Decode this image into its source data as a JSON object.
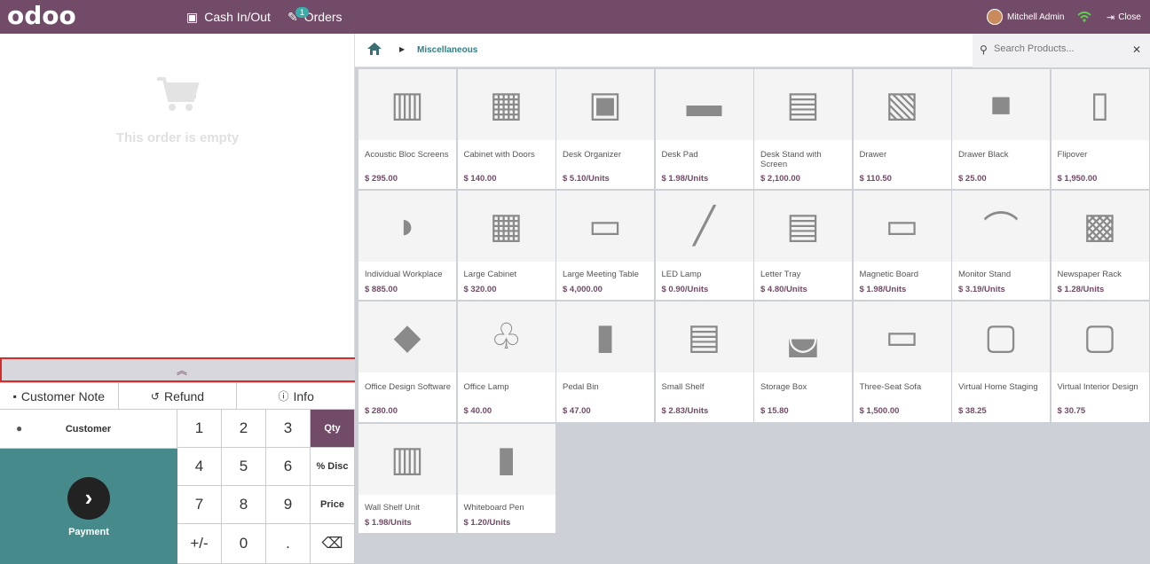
{
  "topbar": {
    "logo": "odoo",
    "cash_label": "Cash In/Out",
    "orders_label": "Orders",
    "orders_badge": "1",
    "user_name": "Mitchell Admin",
    "close_label": "Close",
    "bg_color": "#714b67"
  },
  "order": {
    "empty_text": "This order is empty"
  },
  "controls": {
    "customer_note": "Customer Note",
    "refund": "Refund",
    "info": "Info"
  },
  "numpad": {
    "customer": "Customer",
    "payment": "Payment",
    "keys": [
      "1",
      "2",
      "3",
      "4",
      "5",
      "6",
      "7",
      "8",
      "9",
      "+/-",
      "0",
      "."
    ],
    "qty": "Qty",
    "disc": "% Disc",
    "price": "Price"
  },
  "products_bar": {
    "category": "Miscellaneous",
    "search_placeholder": "Search Products..."
  },
  "products": [
    {
      "name": "Acoustic Bloc Screens",
      "price": "$ 295.00"
    },
    {
      "name": "Cabinet with Doors",
      "price": "$ 140.00"
    },
    {
      "name": "Desk Organizer",
      "price": "$ 5.10/Units"
    },
    {
      "name": "Desk Pad",
      "price": "$ 1.98/Units"
    },
    {
      "name": "Desk Stand with Screen",
      "price": "$ 2,100.00"
    },
    {
      "name": "Drawer",
      "price": "$ 110.50"
    },
    {
      "name": "Drawer Black",
      "price": "$ 25.00"
    },
    {
      "name": "Flipover",
      "price": "$ 1,950.00"
    },
    {
      "name": "Individual Workplace",
      "price": "$ 885.00"
    },
    {
      "name": "Large Cabinet",
      "price": "$ 320.00"
    },
    {
      "name": "Large Meeting Table",
      "price": "$ 4,000.00"
    },
    {
      "name": "LED Lamp",
      "price": "$ 0.90/Units"
    },
    {
      "name": "Letter Tray",
      "price": "$ 4.80/Units"
    },
    {
      "name": "Magnetic Board",
      "price": "$ 1.98/Units"
    },
    {
      "name": "Monitor Stand",
      "price": "$ 3.19/Units"
    },
    {
      "name": "Newspaper Rack",
      "price": "$ 1.28/Units"
    },
    {
      "name": "Office Design Software",
      "price": "$ 280.00"
    },
    {
      "name": "Office Lamp",
      "price": "$ 40.00"
    },
    {
      "name": "Pedal Bin",
      "price": "$ 47.00"
    },
    {
      "name": "Small Shelf",
      "price": "$ 2.83/Units"
    },
    {
      "name": "Storage Box",
      "price": "$ 15.80"
    },
    {
      "name": "Three-Seat Sofa",
      "price": "$ 1,500.00"
    },
    {
      "name": "Virtual Home Staging",
      "price": "$ 38.25"
    },
    {
      "name": "Virtual Interior Design",
      "price": "$ 30.75"
    },
    {
      "name": "Wall Shelf Unit",
      "price": "$ 1.98/Units"
    },
    {
      "name": "Whiteboard Pen",
      "price": "$ 1.20/Units"
    }
  ]
}
